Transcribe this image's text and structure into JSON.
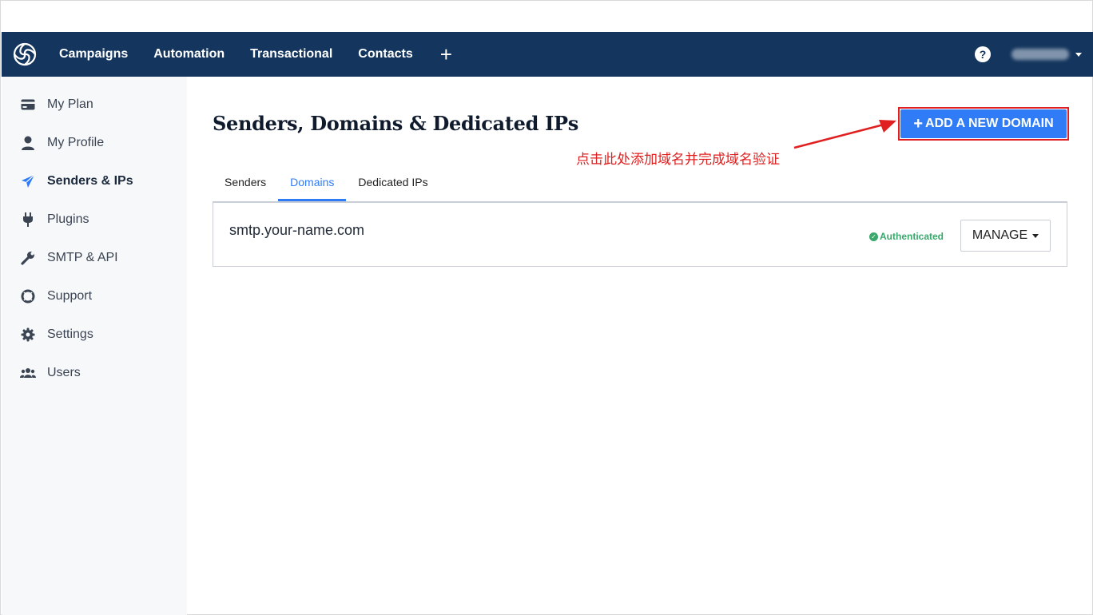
{
  "topbar": {
    "nav": [
      {
        "label": "Campaigns"
      },
      {
        "label": "Automation"
      },
      {
        "label": "Transactional"
      },
      {
        "label": "Contacts"
      }
    ],
    "plus_label": "+",
    "help_label": "?"
  },
  "sidebar": {
    "items": [
      {
        "label": "My Plan",
        "icon": "credit-card-icon"
      },
      {
        "label": "My Profile",
        "icon": "user-icon"
      },
      {
        "label": "Senders & IPs",
        "icon": "paper-plane-icon",
        "active": true
      },
      {
        "label": "Plugins",
        "icon": "plug-icon"
      },
      {
        "label": "SMTP & API",
        "icon": "wrench-icon"
      },
      {
        "label": "Support",
        "icon": "lifebuoy-icon"
      },
      {
        "label": "Settings",
        "icon": "gear-icon"
      },
      {
        "label": "Users",
        "icon": "users-icon"
      }
    ]
  },
  "main": {
    "title": "Senders, Domains & Dedicated IPs",
    "add_button": {
      "plus": "+",
      "label": "ADD A NEW DOMAIN"
    },
    "annotation": "点击此处添加域名并完成域名验证",
    "tabs": [
      {
        "label": "Senders"
      },
      {
        "label": "Domains",
        "active": true
      },
      {
        "label": "Dedicated IPs"
      }
    ],
    "domain_row": {
      "domain": "smtp.your-name.com",
      "status": "Authenticated",
      "manage_label": "MANAGE"
    }
  },
  "colors": {
    "topbar": "#14365e",
    "accent": "#2f7cf6",
    "annotation": "#e02020",
    "success": "#3aa76d"
  }
}
